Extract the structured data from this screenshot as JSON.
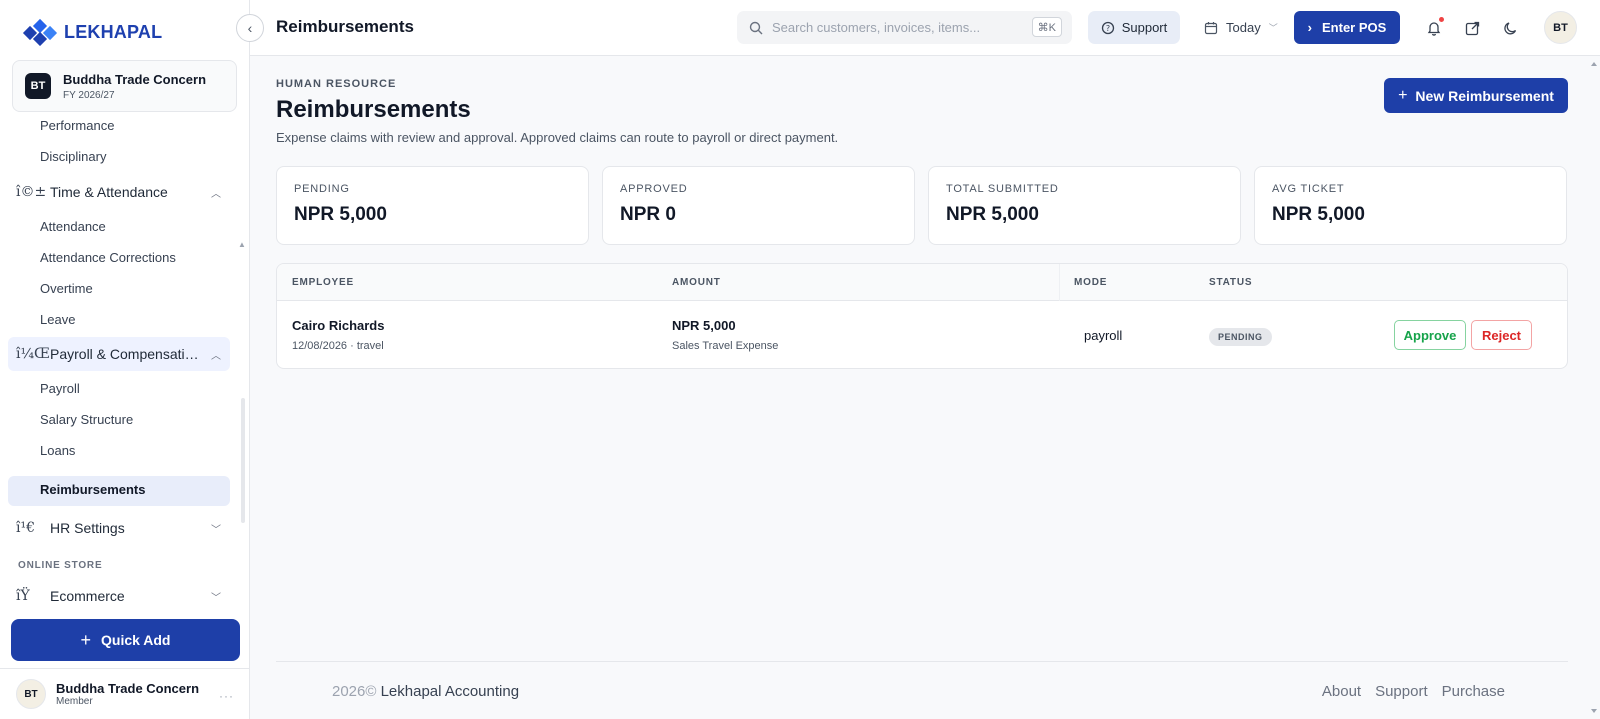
{
  "app": {
    "brand": "LEKHAPAL",
    "company_name": "Buddha Trade Concern",
    "company_initials": "BT",
    "fiscal_year": "FY 2026/27"
  },
  "sidebar": {
    "items": [
      {
        "label": "Performance"
      },
      {
        "label": "Disciplinary"
      },
      {
        "label": "Time & Attendance",
        "icon_glyph": "î©±"
      },
      {
        "label": "Attendance"
      },
      {
        "label": "Attendance Corrections"
      },
      {
        "label": "Overtime"
      },
      {
        "label": "Leave"
      },
      {
        "label": "Payroll & Compensati…",
        "icon_glyph": "î¼Œ"
      },
      {
        "label": "Payroll"
      },
      {
        "label": "Salary Structure"
      },
      {
        "label": "Loans"
      },
      {
        "label": "Reimbursements"
      },
      {
        "label": "HR Settings",
        "icon_glyph": "î¹€"
      },
      {
        "label": "Ecommerce",
        "icon_glyph": "îŸ"
      }
    ],
    "section_online_store": "ONLINE STORE",
    "quick_add_label": "Quick Add",
    "user": {
      "name": "Buddha Trade Concern",
      "role": "Member",
      "initials": "BT"
    }
  },
  "header": {
    "title": "Reimbursements",
    "search_placeholder": "Search customers, invoices, items...",
    "search_shortcut": "⌘K",
    "support_label": "Support",
    "date_label": "Today",
    "pos_label": "Enter POS",
    "avatar_initials": "BT"
  },
  "page": {
    "eyebrow": "HUMAN RESOURCE",
    "title": "Reimbursements",
    "description": "Expense claims with review and approval. Approved claims can route to payroll or direct payment.",
    "new_button_label": "New Reimbursement"
  },
  "stats": [
    {
      "label": "PENDING",
      "value": "NPR 5,000"
    },
    {
      "label": "APPROVED",
      "value": "NPR 0"
    },
    {
      "label": "TOTAL SUBMITTED",
      "value": "NPR 5,000"
    },
    {
      "label": "AVG TICKET",
      "value": "NPR 5,000"
    }
  ],
  "table": {
    "columns": [
      "EMPLOYEE",
      "AMOUNT",
      "MODE",
      "STATUS"
    ],
    "rows": [
      {
        "employee": "Cairo Richards",
        "meta": "12/08/2026 · travel",
        "amount": "NPR 5,000",
        "description": "Sales Travel Expense",
        "mode": "payroll",
        "status": "PENDING",
        "approve_label": "Approve",
        "reject_label": "Reject"
      }
    ]
  },
  "footer": {
    "year": "2026©",
    "company": "Lekhapal Accounting",
    "links": [
      "About",
      "Support",
      "Purchase"
    ]
  },
  "colors": {
    "primary": "#1e3fa8",
    "approve": "#16a34a",
    "reject": "#dc2626",
    "active_bg": "#e8edfa"
  }
}
